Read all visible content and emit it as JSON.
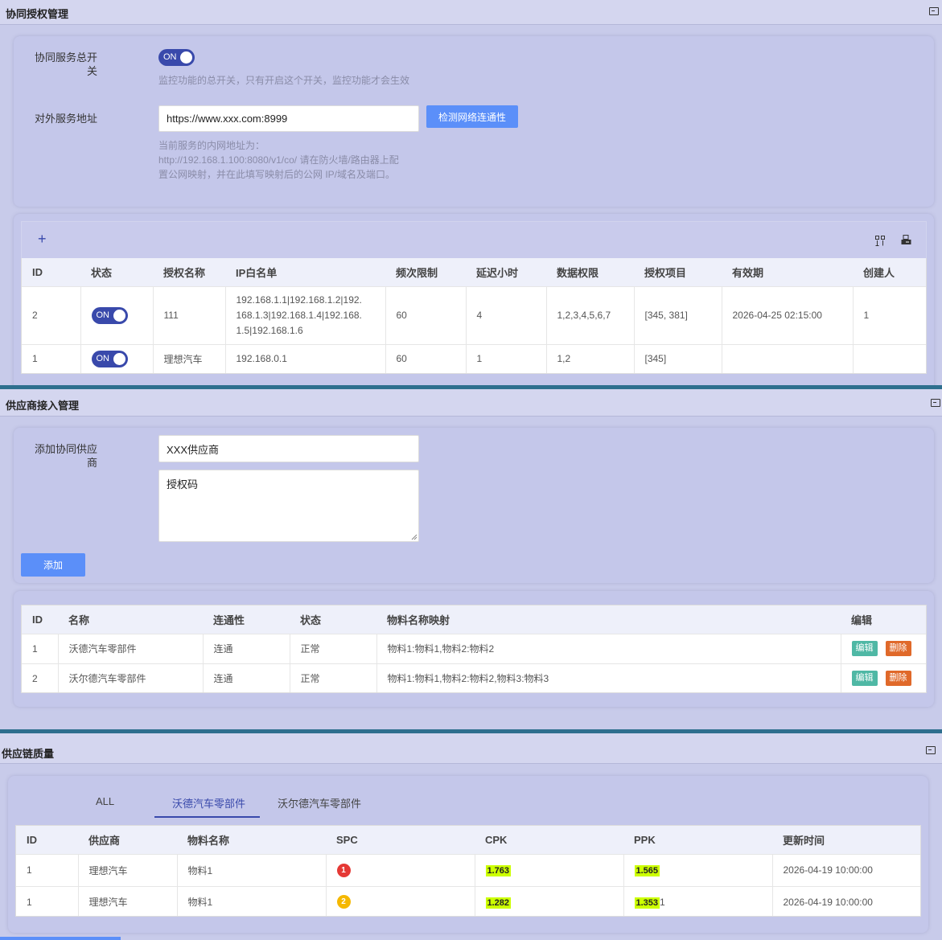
{
  "section1": {
    "title": "协同授权管理",
    "master_switch_label_1": "协同服务总开",
    "master_switch_label_2": "关",
    "master_switch_state": "ON",
    "master_switch_hint": "监控功能的总开关，只有开启这个开关，监控功能才会生效",
    "address_label": "对外服务地址",
    "address_value": "https://www.xxx.com:8999",
    "check_button": "检测网络连通性",
    "address_hint_1": "当前服务的内网地址为：",
    "address_hint_2": "http://192.168.1.100:8080/v1/co/ 请在防火墙/路由器上配",
    "address_hint_3": "置公网映射，并在此填写映射后的公网 IP/域名及端口。",
    "add_icon": "+",
    "columns": [
      "ID",
      "状态",
      "授权名称",
      "IP白名单",
      "频次限制",
      "延迟小时",
      "数据权限",
      "授权项目",
      "有效期",
      "创建人"
    ],
    "rows": [
      {
        "id": "2",
        "status": "ON",
        "name": "111",
        "ip_1": "192.168.1.1|192.168.1.2|192.",
        "ip_2": "168.1.3|192.168.1.4|192.168.",
        "ip_3": "1.5|192.168.1.6",
        "freq": "60",
        "delay": "4",
        "data_perm": "1,2,3,4,5,6,7",
        "project": "[345, 381]",
        "expiry": "2026-04-25 02:15:00",
        "creator": "1"
      },
      {
        "id": "1",
        "status": "ON",
        "name": "理想汽车",
        "ip_1": "192.168.0.1",
        "ip_2": "",
        "ip_3": "",
        "freq": "60",
        "delay": "1",
        "data_perm": "1,2",
        "project": "[345]",
        "expiry": "",
        "creator": ""
      }
    ]
  },
  "section2": {
    "title": "供应商接入管理",
    "add_label_1": "添加协同供应",
    "add_label_2": "商",
    "supplier_value": "XXX供应商",
    "auth_code_value": "授权码",
    "add_button": "添加",
    "columns": [
      "ID",
      "名称",
      "连通性",
      "状态",
      "物料名称映射",
      "编辑"
    ],
    "rows": [
      {
        "id": "1",
        "name": "沃德汽车零部件",
        "conn": "连通",
        "status": "正常",
        "mapping": "物料1:物料1,物料2:物料2",
        "edit": "编辑",
        "delete": "删除"
      },
      {
        "id": "2",
        "name": "沃尔德汽车零部件",
        "conn": "连通",
        "status": "正常",
        "mapping": "物料1:物料1,物料2:物料2,物料3:物料3",
        "edit": "编辑",
        "delete": "删除"
      }
    ]
  },
  "section3": {
    "title": "供应链质量",
    "tabs": [
      "ALL",
      "沃德汽车零部件",
      "沃尔德汽车零部件"
    ],
    "active_tab": 1,
    "columns": [
      "ID",
      "供应商",
      "物料名称",
      "SPC",
      "CPK",
      "PPK",
      "更新时间"
    ],
    "rows": [
      {
        "id": "1",
        "supplier": "理想汽车",
        "material": "物料1",
        "spc": "1",
        "spc_color": "#e53935",
        "cpk": "1.763",
        "ppk": "1.565",
        "ppk_suffix": "",
        "updated": "2026-04-19 10:00:00"
      },
      {
        "id": "1",
        "supplier": "理想汽车",
        "material": "物料1",
        "spc": "2",
        "spc_color": "#f5b800",
        "cpk": "1.282",
        "ppk": "1.353",
        "ppk_suffix": "1",
        "updated": "2026-04-19 10:00:00"
      }
    ]
  },
  "colors": {
    "accent": "#3949ab",
    "button": "#5b8ff9",
    "divider": "#2e6f8e",
    "highlight": "#ccff00"
  }
}
